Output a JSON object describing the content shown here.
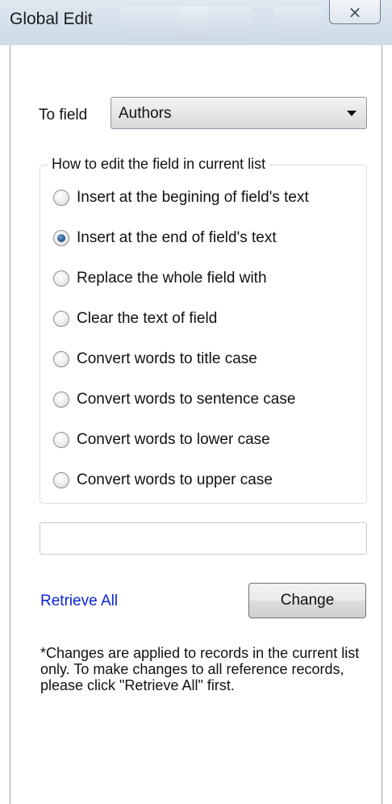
{
  "window": {
    "title": "Global Edit",
    "close_icon": "×"
  },
  "to_field": {
    "label": "To field",
    "selected": "Authors"
  },
  "edit_mode": {
    "legend": "How to edit the field in current list",
    "options": [
      {
        "label": "Insert at the begining of field's text",
        "checked": false
      },
      {
        "label": "Insert at the end of field's text",
        "checked": true
      },
      {
        "label": "Replace the whole field with",
        "checked": false
      },
      {
        "label": "Clear the text of field",
        "checked": false
      },
      {
        "label": "Convert words to title case",
        "checked": false
      },
      {
        "label": "Convert words to sentence case",
        "checked": false
      },
      {
        "label": "Convert words to lower case",
        "checked": false
      },
      {
        "label": "Convert words to upper case",
        "checked": false
      }
    ]
  },
  "text_input": {
    "value": ""
  },
  "actions": {
    "retrieve_all": "Retrieve All",
    "change": "Change"
  },
  "note": "*Changes are applied to records in the current list only. To make changes to all reference records, please click \"Retrieve All\" first."
}
